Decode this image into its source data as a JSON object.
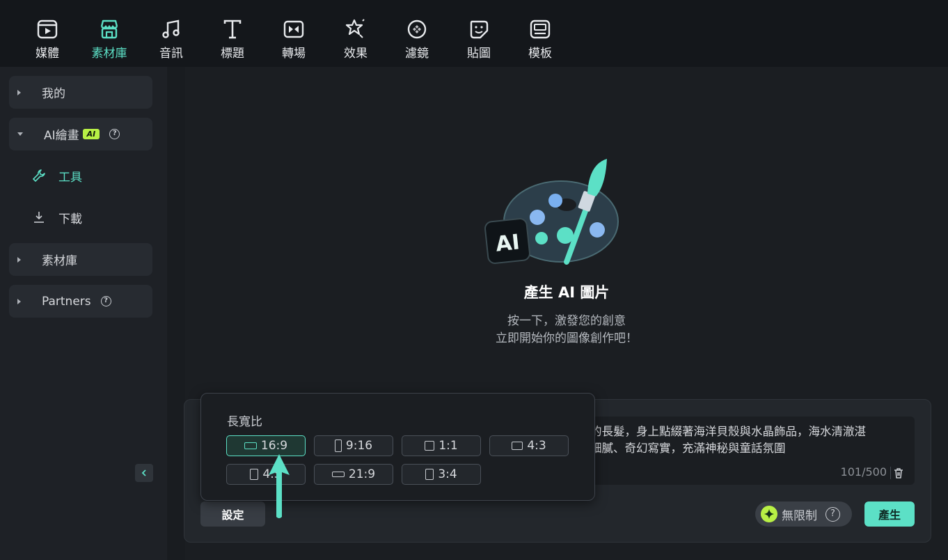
{
  "toolbar": {
    "items": [
      {
        "label": "媒體",
        "icon": "media-icon"
      },
      {
        "label": "素材庫",
        "icon": "store-icon"
      },
      {
        "label": "音訊",
        "icon": "music-note-icon"
      },
      {
        "label": "標題",
        "icon": "title-t-icon"
      },
      {
        "label": "轉場",
        "icon": "transition-icon"
      },
      {
        "label": "效果",
        "icon": "effects-icon"
      },
      {
        "label": "濾鏡",
        "icon": "filter-icon"
      },
      {
        "label": "貼圖",
        "icon": "sticker-icon"
      },
      {
        "label": "模板",
        "icon": "template-icon"
      }
    ],
    "active_index": 1
  },
  "sidebar": {
    "my": "我的",
    "ai_paint": "AI繪畫",
    "ai_badge": "AI",
    "tools": "工具",
    "download": "下載",
    "library": "素材庫",
    "partners": "Partners"
  },
  "main": {
    "title": "產生 AI 圖片",
    "subtitle_line1": "按一下，激發您的創意",
    "subtitle_line2": "立即開始你的圖像創作吧！",
    "prompt_line1": "的長髮，身上點綴著海洋貝殼與水晶飾品，海水清澈湛",
    "prompt_line2": "細膩、奇幻寫實，充滿神秘與童話氛圍",
    "counter": "101/500",
    "settings_label": "設定",
    "unlimited_label": "無限制",
    "generate_label": "產生"
  },
  "aspect": {
    "title": "長寬比",
    "options": [
      "16:9",
      "9:16",
      "1:1",
      "4:3",
      "4:5",
      "21:9",
      "3:4"
    ],
    "selected": "16:9"
  },
  "colors": {
    "accent": "#5ce0c6",
    "badge": "#b8f045",
    "background": "#1b1e22"
  }
}
